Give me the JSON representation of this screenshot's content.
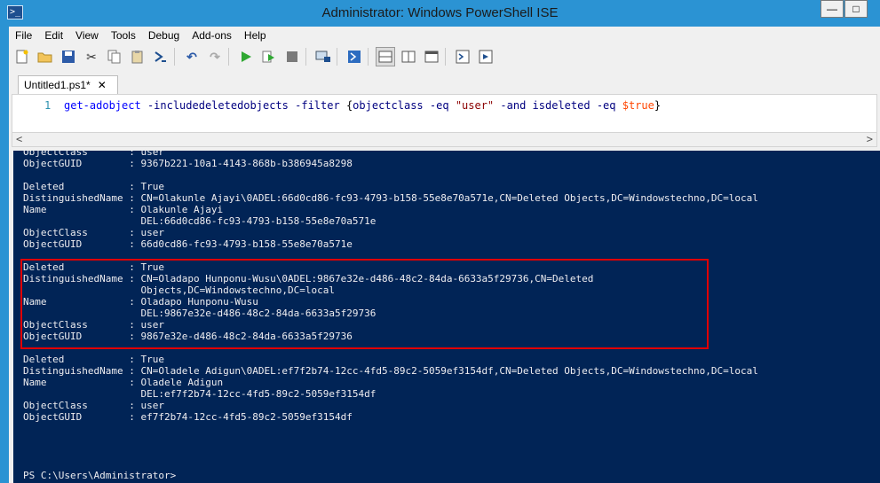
{
  "window": {
    "title": "Administrator: Windows PowerShell ISE"
  },
  "menu": [
    "File",
    "Edit",
    "View",
    "Tools",
    "Debug",
    "Add-ons",
    "Help"
  ],
  "toolbar": [
    "new-icon",
    "open-icon",
    "save-icon",
    "cut-icon",
    "copy-icon",
    "paste-icon",
    "powershell-icon",
    "undo-icon",
    "redo-icon",
    "run-icon",
    "run-selection-icon",
    "stop-icon",
    "remote-icon",
    "powershell-tab-icon",
    "layout-top-icon",
    "layout-right-icon",
    "layout-max-icon",
    "commands-icon",
    "addon-icon"
  ],
  "tab": {
    "label": "Untitled1.ps1*",
    "close": "✕"
  },
  "editor": {
    "line_number": "1",
    "cmd": "get-adobject",
    "p1": "-includedeletedobjects",
    "p2": "-filter",
    "brace_open": "{",
    "prop1": "objectclass",
    "op1": "-eq",
    "str": "\"user\"",
    "op2": "-and",
    "prop2": "isdeleted",
    "op3": "-eq",
    "var": "$true",
    "brace_close": "}"
  },
  "console": {
    "lines": [
      "ObjectClass       : user",
      "ObjectGUID        : 9367b221-10a1-4143-868b-b386945a8298",
      "",
      "Deleted           : True",
      "DistinguishedName : CN=Olakunle Ajayi\\0ADEL:66d0cd86-fc93-4793-b158-55e8e70a571e,CN=Deleted Objects,DC=Windowstechno,DC=local",
      "Name              : Olakunle Ajayi",
      "                    DEL:66d0cd86-fc93-4793-b158-55e8e70a571e",
      "ObjectClass       : user",
      "ObjectGUID        : 66d0cd86-fc93-4793-b158-55e8e70a571e",
      "",
      "Deleted           : True",
      "DistinguishedName : CN=Oladapo Hunponu-Wusu\\0ADEL:9867e32e-d486-48c2-84da-6633a5f29736,CN=Deleted",
      "                    Objects,DC=Windowstechno,DC=local",
      "Name              : Oladapo Hunponu-Wusu",
      "                    DEL:9867e32e-d486-48c2-84da-6633a5f29736",
      "ObjectClass       : user",
      "ObjectGUID        : 9867e32e-d486-48c2-84da-6633a5f29736",
      "",
      "Deleted           : True",
      "DistinguishedName : CN=Oladele Adigun\\0ADEL:ef7f2b74-12cc-4fd5-89c2-5059ef3154df,CN=Deleted Objects,DC=Windowstechno,DC=local",
      "Name              : Oladele Adigun",
      "                    DEL:ef7f2b74-12cc-4fd5-89c2-5059ef3154df",
      "ObjectClass       : user",
      "ObjectGUID        : ef7f2b74-12cc-4fd5-89c2-5059ef3154df"
    ],
    "prompt": "PS C:\\Users\\Administrator>"
  }
}
